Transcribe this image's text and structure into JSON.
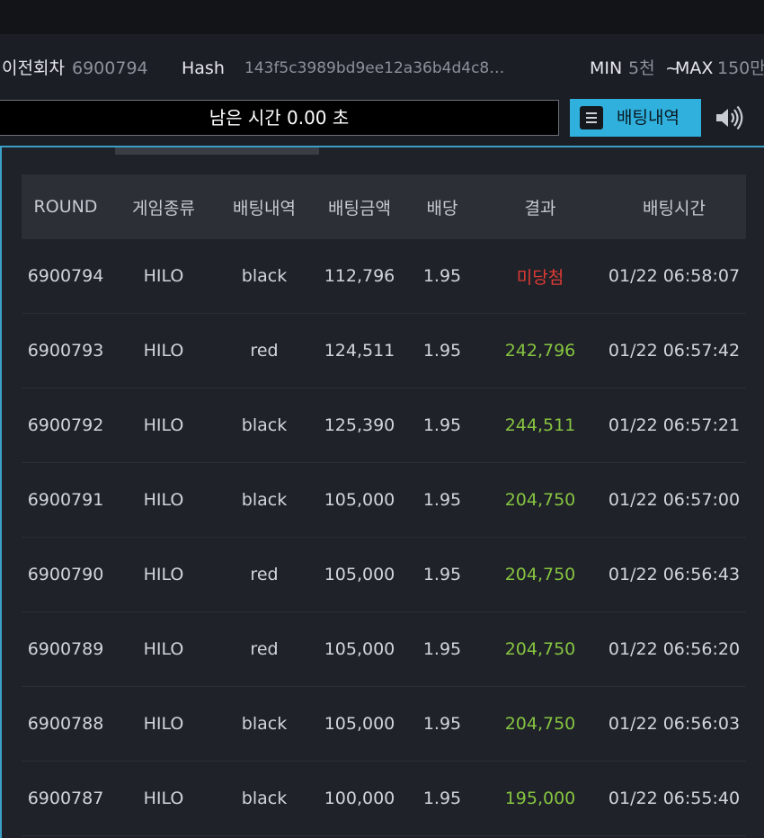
{
  "info": {
    "prev_round_label": "이전회차",
    "prev_round_value": "6900794",
    "hash_label": "Hash",
    "hash_value": "143f5c3989bd9ee12a36b4d4c8…",
    "min_label": "MIN",
    "min_value": "5천",
    "tilde": "~",
    "max_label": "MAX",
    "max_value": "150만"
  },
  "timer": {
    "text": "남은 시간 0.00 초"
  },
  "history_button": {
    "label": "배팅내역",
    "icon": "list-icon"
  },
  "sound_icon": "speaker-icon",
  "colors": {
    "accent": "#2fb0dd",
    "win": "#86c440",
    "lose": "#e03a34"
  },
  "table": {
    "headers": [
      "ROUND",
      "게임종류",
      "배팅내역",
      "배팅금액",
      "배당",
      "결과",
      "배팅시간"
    ],
    "rows": [
      {
        "round": "6900794",
        "game": "HILO",
        "bet": "black",
        "amount": "112,796",
        "odds": "1.95",
        "result": "미당첨",
        "time": "01/22 06:58:07"
      },
      {
        "round": "6900793",
        "game": "HILO",
        "bet": "red",
        "amount": "124,511",
        "odds": "1.95",
        "result": "242,796",
        "time": "01/22 06:57:42"
      },
      {
        "round": "6900792",
        "game": "HILO",
        "bet": "black",
        "amount": "125,390",
        "odds": "1.95",
        "result": "244,511",
        "time": "01/22 06:57:21"
      },
      {
        "round": "6900791",
        "game": "HILO",
        "bet": "black",
        "amount": "105,000",
        "odds": "1.95",
        "result": "204,750",
        "time": "01/22 06:57:00"
      },
      {
        "round": "6900790",
        "game": "HILO",
        "bet": "red",
        "amount": "105,000",
        "odds": "1.95",
        "result": "204,750",
        "time": "01/22 06:56:43"
      },
      {
        "round": "6900789",
        "game": "HILO",
        "bet": "red",
        "amount": "105,000",
        "odds": "1.95",
        "result": "204,750",
        "time": "01/22 06:56:20"
      },
      {
        "round": "6900788",
        "game": "HILO",
        "bet": "black",
        "amount": "105,000",
        "odds": "1.95",
        "result": "204,750",
        "time": "01/22 06:56:03"
      },
      {
        "round": "6900787",
        "game": "HILO",
        "bet": "black",
        "amount": "100,000",
        "odds": "1.95",
        "result": "195,000",
        "time": "01/22 06:55:40"
      }
    ]
  }
}
